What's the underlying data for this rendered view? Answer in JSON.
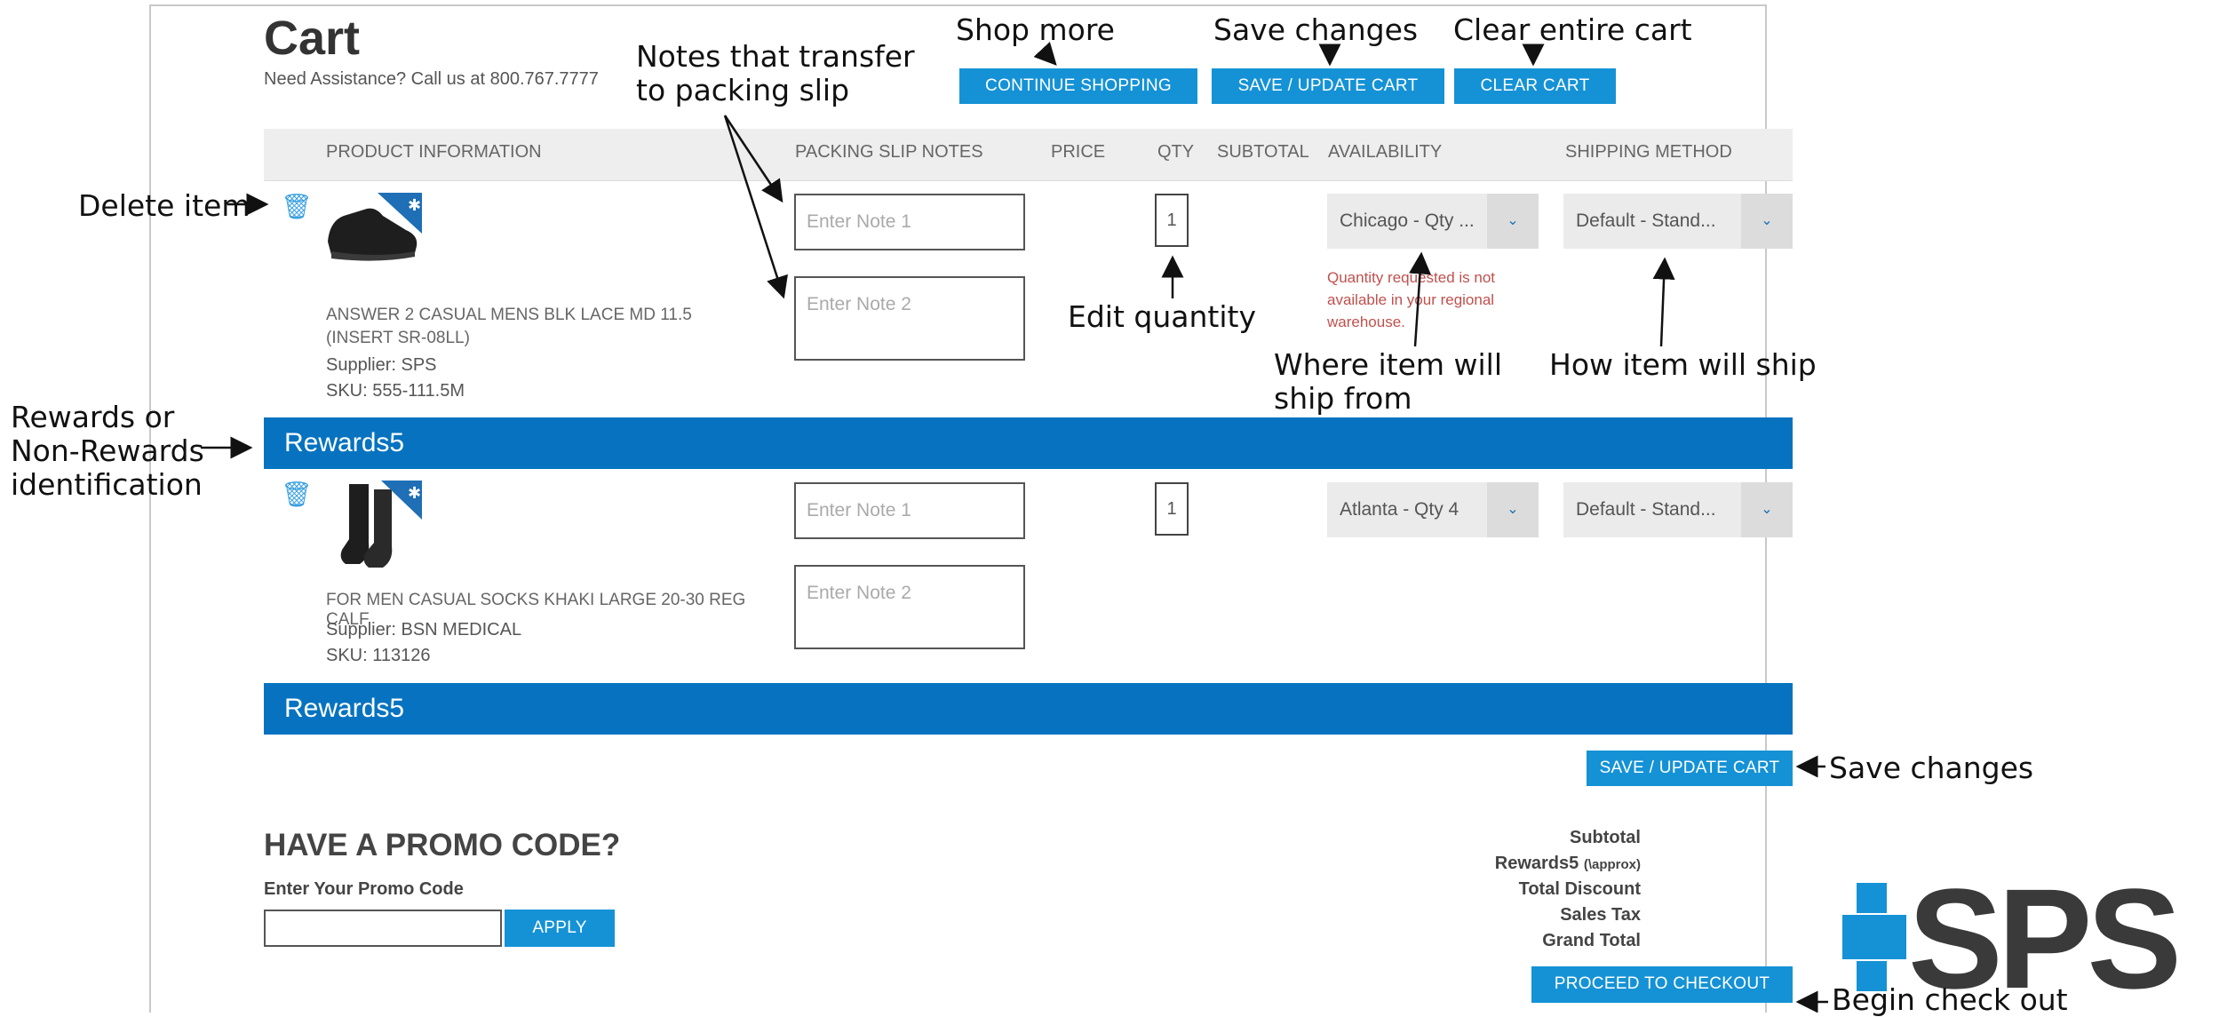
{
  "header": {
    "title": "Cart",
    "assistance": "Need Assistance? Call us at 800.767.7777"
  },
  "buttons": {
    "continue": "CONTINUE SHOPPING",
    "save_update": "SAVE / UPDATE CART",
    "clear": "CLEAR CART",
    "apply": "APPLY",
    "checkout": "PROCEED TO CHECKOUT"
  },
  "table": {
    "columns": [
      "PRODUCT INFORMATION",
      "PACKING SLIP NOTES",
      "PRICE",
      "QTY",
      "SUBTOTAL",
      "AVAILABILITY",
      "SHIPPING METHOD"
    ]
  },
  "items": [
    {
      "name": "ANSWER 2 CASUAL MENS BLK LACE MD 11.5 (INSERT SR-08LL)",
      "supplier": "Supplier: SPS",
      "sku": "SKU: 555-111.5M",
      "note1_placeholder": "Enter Note 1",
      "note2_placeholder": "Enter Note 2",
      "qty": "1",
      "availability": "Chicago - Qty ...",
      "shipping": "Default - Stand...",
      "warning": "Quantity requested is not available in your regional warehouse.",
      "rewards": "Rewards5"
    },
    {
      "name": "FOR MEN CASUAL SOCKS KHAKI LARGE 20-30 REG CALF",
      "supplier": "Supplier: BSN MEDICAL",
      "sku": "SKU: 113126",
      "note1_placeholder": "Enter Note 1",
      "note2_placeholder": "Enter Note 2",
      "qty": "1",
      "availability": "Atlanta - Qty 4",
      "shipping": "Default - Stand...",
      "rewards": "Rewards5"
    }
  ],
  "promo": {
    "title": "HAVE A PROMO CODE?",
    "label": "Enter Your Promo Code"
  },
  "totals": {
    "subtotal": "Subtotal",
    "rewards_label": "Rewards5",
    "rewards_note": "(\\approx)",
    "discount": "Total Discount",
    "tax": "Sales Tax",
    "grand": "Grand Total"
  },
  "annotations": {
    "shop_more": "Shop more",
    "save_changes_top": "Save changes",
    "clear_cart": "Clear entire cart",
    "notes_line1": "Notes that transfer",
    "notes_line2": "to packing slip",
    "delete_item": "Delete item",
    "edit_qty": "Edit quantity",
    "ship_from_line1": "Where item will",
    "ship_from_line2": "ship from",
    "how_ship": "How item will ship",
    "rewards_line1": "Rewards or",
    "rewards_line2": "Non-Rewards",
    "rewards_line3": "identification",
    "save_changes_bottom": "Save changes",
    "begin_checkout": "Begin check out"
  },
  "logo": {
    "text": "SPS"
  },
  "colors": {
    "primary_button": "#1592d6",
    "rewards_bar": "#0773c0",
    "warning": "#c0504d"
  }
}
